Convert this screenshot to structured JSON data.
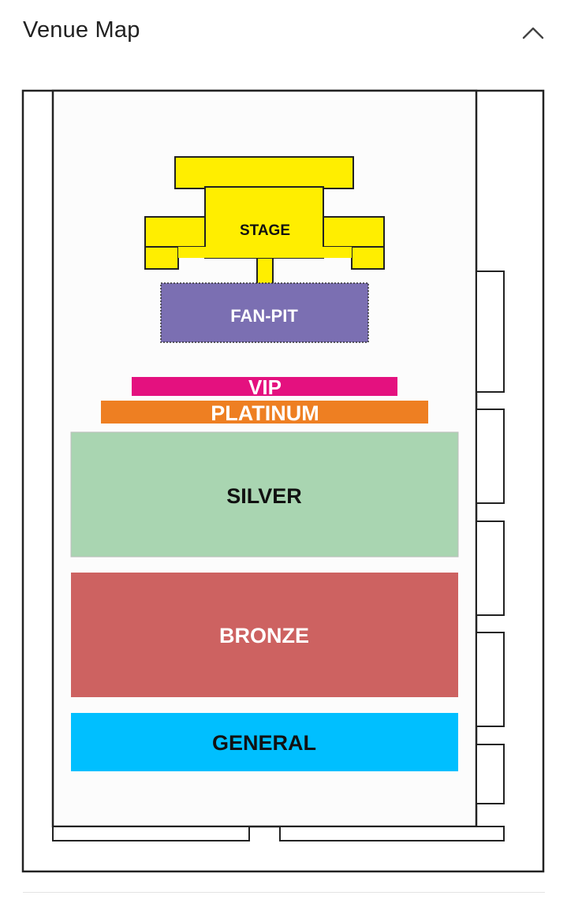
{
  "header": {
    "title": "Venue Map",
    "collapse_icon": "chevron-up-icon"
  },
  "venue_map": {
    "stage": {
      "label": "STAGE",
      "color": "#FFEE00"
    },
    "sections": [
      {
        "id": "fan-pit",
        "label": "FAN-PIT",
        "color": "#7B6FB2",
        "text_color": "#FFFFFF"
      },
      {
        "id": "vip",
        "label": "VIP",
        "color": "#E4117F",
        "text_color": "#FFFFFF"
      },
      {
        "id": "platinum",
        "label": "PLATINUM",
        "color": "#EE7F22",
        "text_color": "#FFFFFF"
      },
      {
        "id": "silver",
        "label": "SILVER",
        "color": "#A9D5B1",
        "text_color": "#111111"
      },
      {
        "id": "bronze",
        "label": "BRONZE",
        "color": "#CD6261",
        "text_color": "#FFFFFF"
      },
      {
        "id": "general",
        "label": "GENERAL",
        "color": "#00BFFF",
        "text_color": "#111111"
      }
    ]
  }
}
